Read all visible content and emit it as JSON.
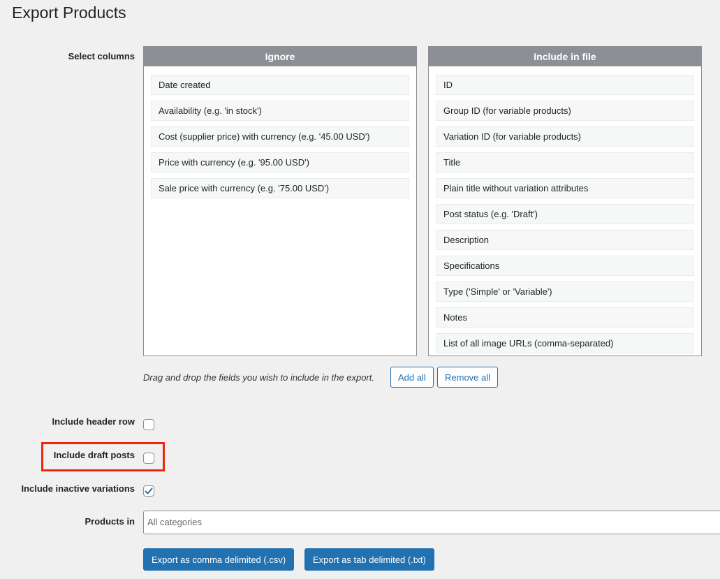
{
  "title": "Export Products",
  "select_columns_label": "Select columns",
  "ignore": {
    "heading": "Ignore",
    "items": [
      "Date created",
      "Availability (e.g. 'in stock')",
      "Cost (supplier price) with currency (e.g. '45.00 USD')",
      "Price with currency (e.g. '95.00 USD')",
      "Sale price with currency (e.g. '75.00 USD')"
    ]
  },
  "include": {
    "heading": "Include in file",
    "items": [
      "ID",
      "Group ID (for variable products)",
      "Variation ID (for variable products)",
      "Title",
      "Plain title without variation attributes",
      "Post status (e.g. 'Draft')",
      "Description",
      "Specifications",
      "Type ('Simple' or 'Variable')",
      "Notes",
      "List of all image URLs (comma-separated)"
    ]
  },
  "hint": "Drag and drop the fields you wish to include in the export.",
  "add_all_label": "Add all",
  "remove_all_label": "Remove all",
  "options": {
    "header_row": {
      "label": "Include header row",
      "checked": false
    },
    "draft_posts": {
      "label": "Include draft posts",
      "checked": false
    },
    "inactive_variations": {
      "label": "Include inactive variations",
      "checked": true
    }
  },
  "products_in": {
    "label": "Products in",
    "placeholder": "All categories"
  },
  "export_csv_label": "Export as comma delimited (.csv)",
  "export_txt_label": "Export as tab delimited (.txt)",
  "colors": {
    "primary": "#2271b1",
    "highlight": "#e8290c",
    "header_gray": "#8c8f94"
  }
}
